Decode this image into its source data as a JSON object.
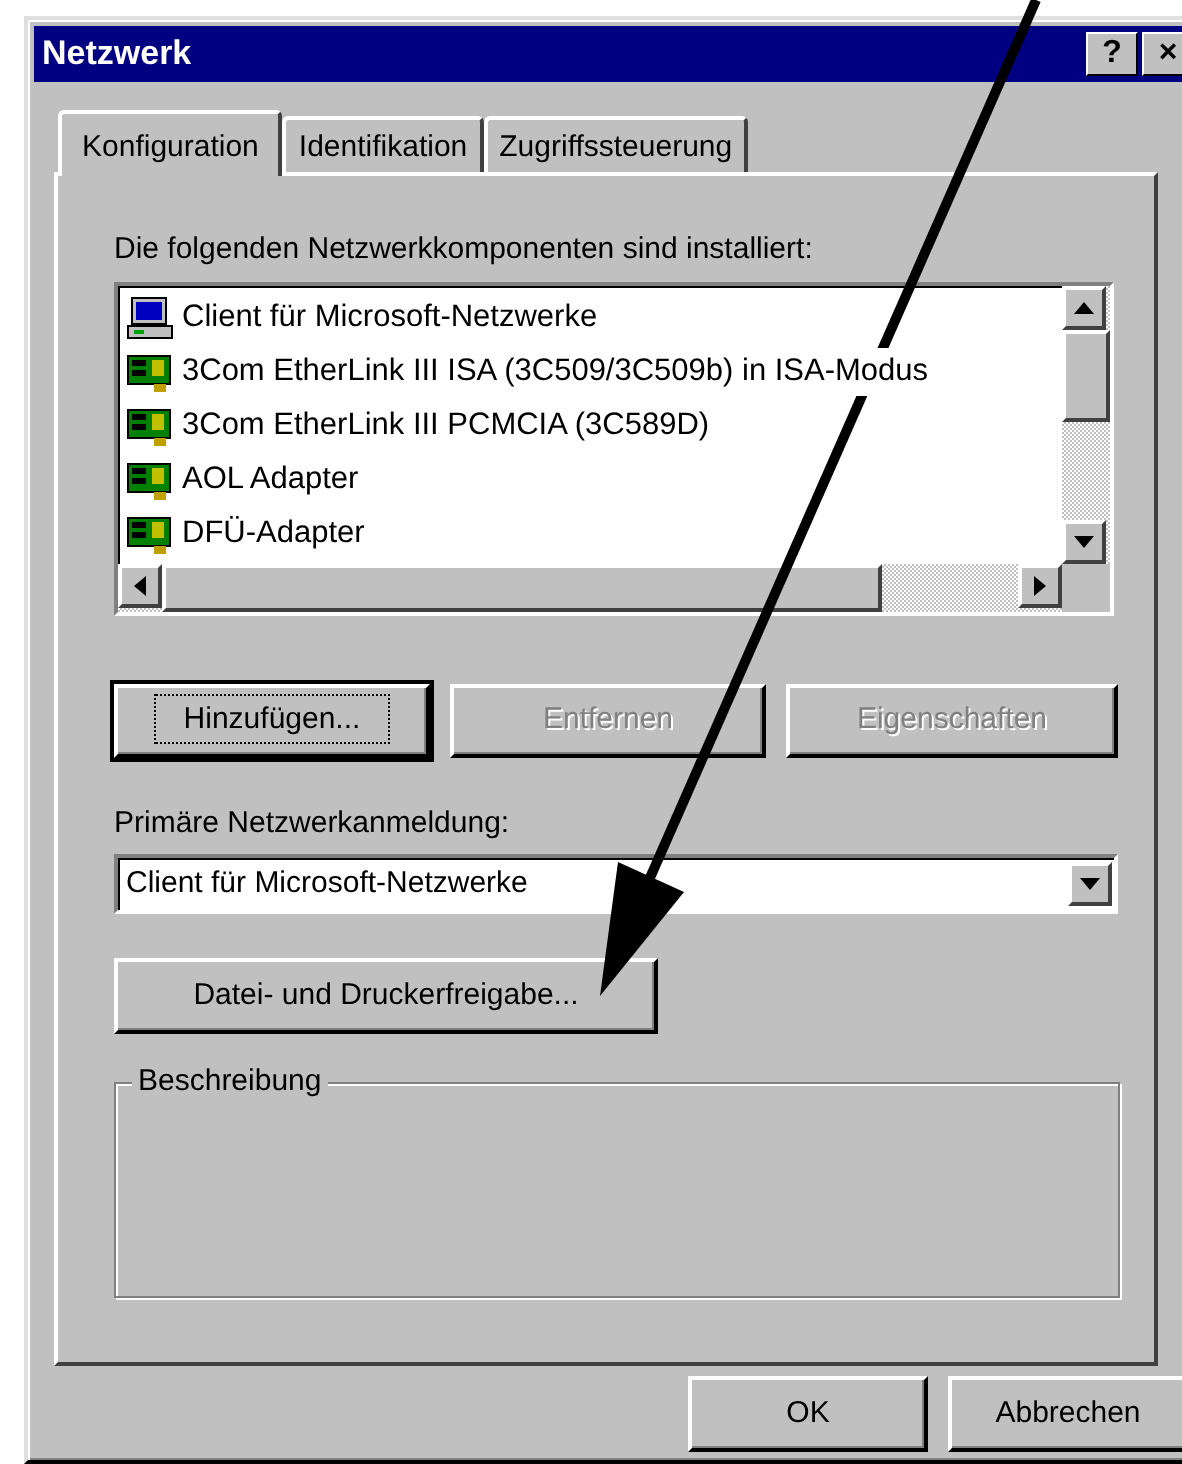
{
  "window": {
    "title": "Netzwerk",
    "title_buttons": [
      "?",
      "×"
    ]
  },
  "tabs": [
    {
      "label": "Konfiguration",
      "selected": true
    },
    {
      "label": "Identifikation",
      "selected": false
    },
    {
      "label": "Zugriffssteuerung",
      "selected": false
    }
  ],
  "components": {
    "label": "Die folgenden Netzwerkkomponenten sind installiert:",
    "items": [
      {
        "kind": "client",
        "text": "Client für Microsoft-Netzwerke"
      },
      {
        "kind": "adapter",
        "text": "3Com EtherLink III ISA (3C509/3C509b) in ISA-Modus"
      },
      {
        "kind": "adapter",
        "text": "3Com EtherLink III PCMCIA (3C589D)"
      },
      {
        "kind": "adapter",
        "text": "AOL Adapter"
      },
      {
        "kind": "adapter",
        "text": "DFÜ-Adapter"
      }
    ]
  },
  "component_buttons": [
    {
      "label": "Hinzufügen...",
      "disabled": false,
      "focused": true
    },
    {
      "label": "Entfernen",
      "disabled": true,
      "focused": false
    },
    {
      "label": "Eigenschaften",
      "disabled": true,
      "focused": false
    }
  ],
  "primary_logon": {
    "label": "Primäre Netzwerkanmeldung:",
    "value": "Client für Microsoft-Netzwerke"
  },
  "sharing_button": "Datei- und Druckerfreigabe...",
  "description": {
    "title": "Beschreibung"
  },
  "buttons": [
    "OK",
    "Abbrechen"
  ]
}
